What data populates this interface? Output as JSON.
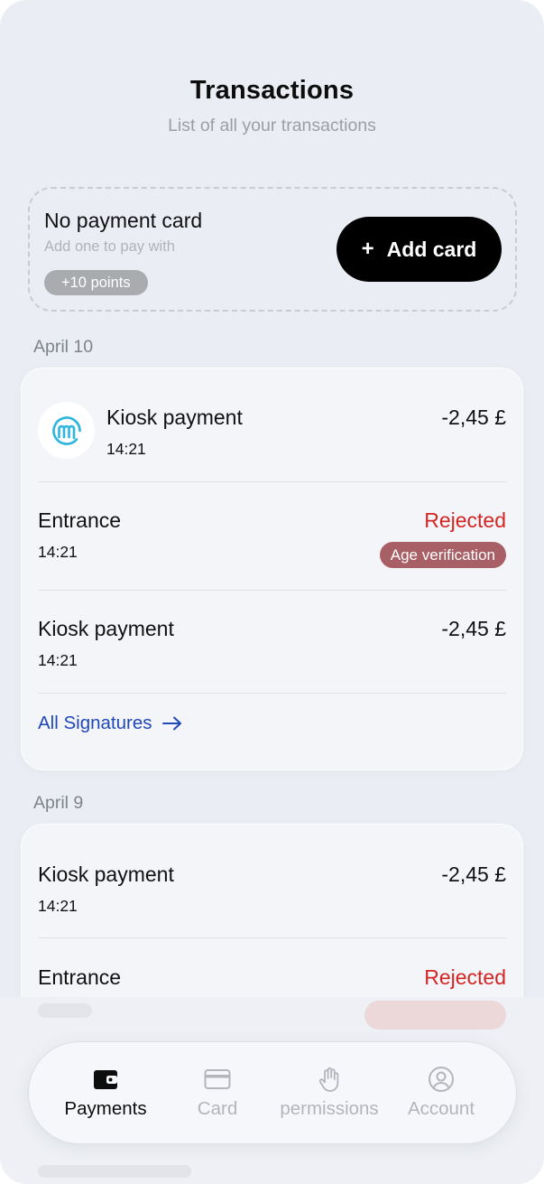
{
  "header": {
    "title": "Transactions",
    "subtitle": "List of all your transactions"
  },
  "no_card": {
    "title": "No payment card",
    "subtitle": "Add one to pay with",
    "points": "+10 points",
    "add_button": {
      "icon": "+",
      "label": "Add card"
    }
  },
  "groups": [
    {
      "date": "April 10",
      "rows": [
        {
          "title": "Kiosk payment",
          "time": "14:21",
          "amount": "-2,45 £",
          "logo": "m-merchant-logo"
        },
        {
          "title": "Entrance",
          "time": "14:21",
          "status": "Rejected",
          "badge": "Age verification"
        },
        {
          "title": "Kiosk payment",
          "time": "14:21",
          "amount": "-2,45 £"
        }
      ],
      "link": "All Signatures"
    },
    {
      "date": "April 9",
      "rows": [
        {
          "title": "Kiosk payment",
          "time": "14:21",
          "amount": "-2,45 £"
        },
        {
          "title": "Entrance",
          "status": "Rejected"
        }
      ]
    }
  ],
  "tabbar": {
    "tabs": [
      {
        "label": "Payments",
        "icon": "wallet-icon",
        "active": true
      },
      {
        "label": "Card",
        "icon": "card-icon",
        "active": false
      },
      {
        "label": "permissions",
        "icon": "hand-icon",
        "active": false
      },
      {
        "label": "Account",
        "icon": "user-circle-icon",
        "active": false
      }
    ]
  },
  "colors": {
    "background": "#ebedf4",
    "rejected": "#d42525",
    "badge": "#a85f66",
    "link": "#1f48b8",
    "logo_accent": "#2bb5df"
  }
}
